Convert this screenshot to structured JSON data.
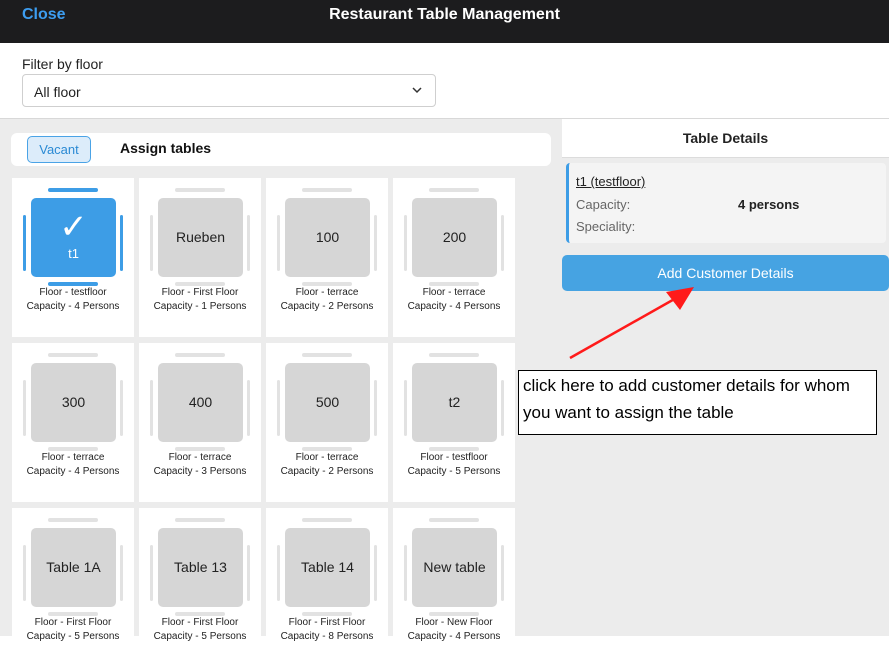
{
  "header": {
    "close_label": "Close",
    "title": "Restaurant Table Management"
  },
  "filter": {
    "label": "Filter by floor",
    "selected": "All floor"
  },
  "tabs": {
    "vacant": "Vacant",
    "assign": "Assign tables"
  },
  "tables": [
    {
      "name": "t1",
      "floor": "Floor - testfloor",
      "capacity": "Capacity - 4 Persons",
      "selected": true
    },
    {
      "name": "Rueben",
      "floor": "Floor - First Floor",
      "capacity": "Capacity - 1 Persons"
    },
    {
      "name": "100",
      "floor": "Floor - terrace",
      "capacity": "Capacity - 2 Persons"
    },
    {
      "name": "200",
      "floor": "Floor - terrace",
      "capacity": "Capacity - 4 Persons"
    },
    {
      "name": "300",
      "floor": "Floor - terrace",
      "capacity": "Capacity - 4 Persons"
    },
    {
      "name": "400",
      "floor": "Floor - terrace",
      "capacity": "Capacity - 3 Persons"
    },
    {
      "name": "500",
      "floor": "Floor - terrace",
      "capacity": "Capacity - 2 Persons"
    },
    {
      "name": "t2",
      "floor": "Floor - testfloor",
      "capacity": "Capacity - 5 Persons"
    },
    {
      "name": "Table 1A",
      "floor": "Floor - First Floor",
      "capacity": "Capacity - 5 Persons"
    },
    {
      "name": "Table 13",
      "floor": "Floor - First Floor",
      "capacity": "Capacity - 5 Persons"
    },
    {
      "name": "Table 14",
      "floor": "Floor - First Floor",
      "capacity": "Capacity - 8 Persons"
    },
    {
      "name": "New table",
      "floor": "Floor - New Floor",
      "capacity": "Capacity - 4 Persons"
    }
  ],
  "details": {
    "title": "Table Details",
    "name": "t1 (testfloor)",
    "capacity_label": "Capacity:",
    "capacity_value": "4 persons",
    "speciality_label": "Speciality:",
    "add_button": "Add Customer Details"
  },
  "callout": {
    "text": "click here to add customer details for whom you want to assign the table"
  },
  "colors": {
    "accent": "#3d9de6",
    "arrow": "#ff1a1a",
    "topbar": "#1c1c1e"
  }
}
